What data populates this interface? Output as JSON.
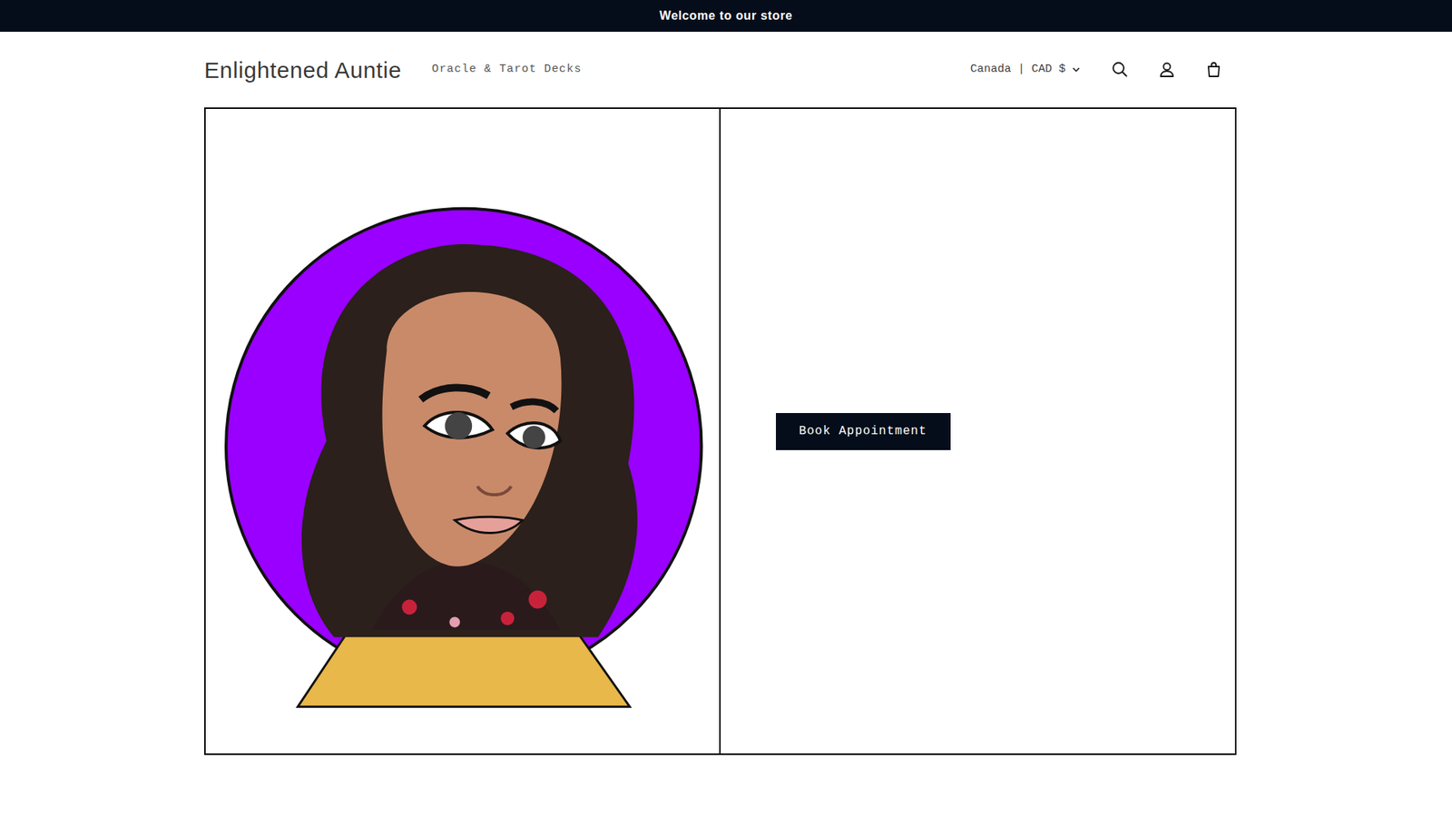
{
  "announcement": "Welcome to our store",
  "header": {
    "brand": "Enlightened Auntie",
    "nav": [
      {
        "label": "Oracle & Tarot Decks",
        "selected": false
      }
    ],
    "currency": "Canada | CAD $"
  },
  "hero": {
    "button": "Book Appointment"
  }
}
